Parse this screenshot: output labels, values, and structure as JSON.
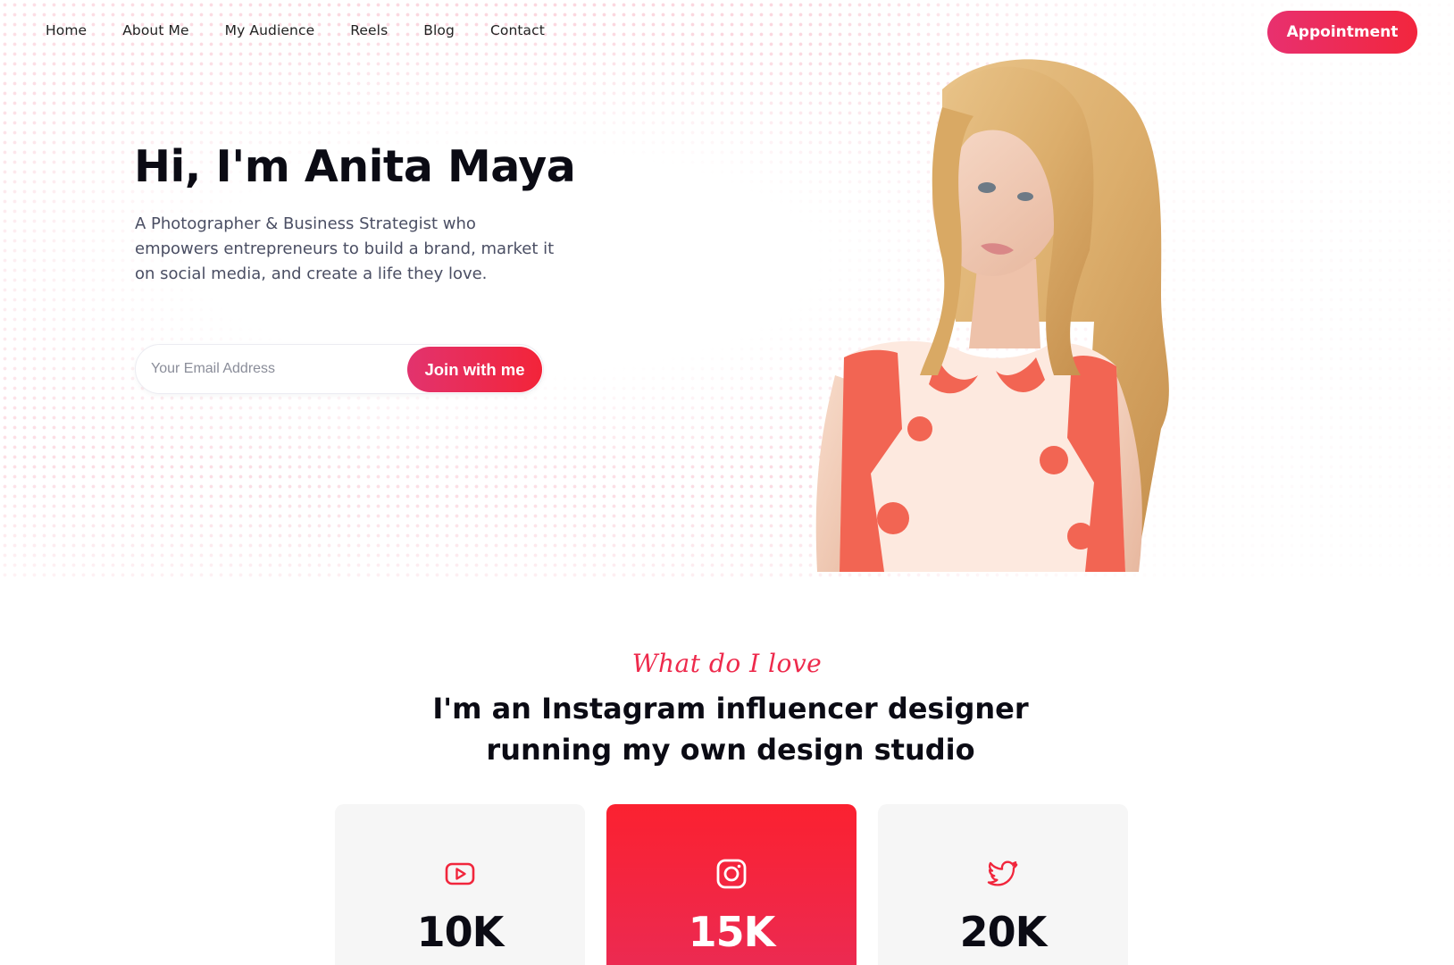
{
  "nav": {
    "links": [
      "Home",
      "About Me",
      "My Audience",
      "Reels",
      "Blog",
      "Contact"
    ],
    "cta": "Appointment"
  },
  "hero": {
    "title": "Hi, I'm Anita Maya",
    "description": "A Photographer & Business Strategist who empowers entrepreneurs to build a brand, market it on social media, and create a life they love.",
    "email_placeholder": "Your Email Address",
    "join_label": "Join with me"
  },
  "about": {
    "script_title": "What do I love",
    "title_line1": "I'm an Instagram influencer designer",
    "title_line2": "running my own design studio"
  },
  "stats": [
    {
      "platform_icon": "youtube-icon",
      "count": "10K",
      "active": false
    },
    {
      "platform_icon": "instagram-icon",
      "count": "15K",
      "active": true
    },
    {
      "platform_icon": "twitter-icon",
      "count": "20K",
      "active": false
    }
  ],
  "colors": {
    "accent": "#f2263d",
    "accent_pink": "#e8306f",
    "text_dark": "#0b0b14",
    "text_muted": "#4a4e63",
    "card_bg": "#f6f6f6"
  }
}
